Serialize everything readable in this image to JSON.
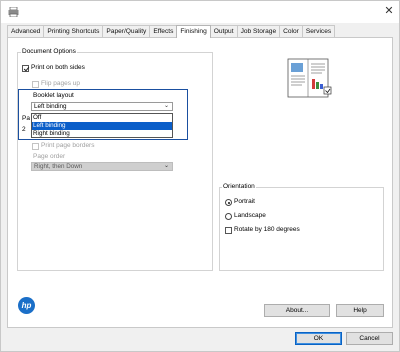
{
  "tabs": [
    {
      "label": "Advanced"
    },
    {
      "label": "Printing Shortcuts"
    },
    {
      "label": "Paper/Quality"
    },
    {
      "label": "Effects"
    },
    {
      "label": "Finishing",
      "active": true
    },
    {
      "label": "Output"
    },
    {
      "label": "Job Storage"
    },
    {
      "label": "Color"
    },
    {
      "label": "Services"
    }
  ],
  "document_options": {
    "title": "Document Options",
    "print_both_sides": {
      "label": "Print on both sides",
      "checked": true
    },
    "flip_pages_up": {
      "label": "Flip pages up",
      "checked": false,
      "enabled": false
    },
    "booklet_layout": {
      "label": "Booklet layout",
      "value": "Left binding",
      "options": [
        "Off",
        "Left binding",
        "Right binding"
      ],
      "highlighted_option": "Left binding"
    },
    "pages_per_sheet_label_partial": "Pa",
    "pages_per_sheet_value_partial": "2",
    "print_page_borders": {
      "label": "Print page borders",
      "checked": false,
      "enabled": false
    },
    "page_order": {
      "label": "Page order",
      "value": "Right, then Down",
      "enabled": false
    }
  },
  "orientation": {
    "title": "Orientation",
    "portrait": {
      "label": "Portrait",
      "selected": true
    },
    "landscape": {
      "label": "Landscape",
      "selected": false
    },
    "rotate_180": {
      "label": "Rotate by 180 degrees",
      "checked": false
    }
  },
  "logo": {
    "text": "hp",
    "color": "#1b6fc8"
  },
  "buttons": {
    "about": "About...",
    "help": "Help",
    "ok": "OK",
    "cancel": "Cancel"
  },
  "colors": {
    "accent": "#0a5ec9",
    "highlight_border": "#1a4fa0"
  }
}
